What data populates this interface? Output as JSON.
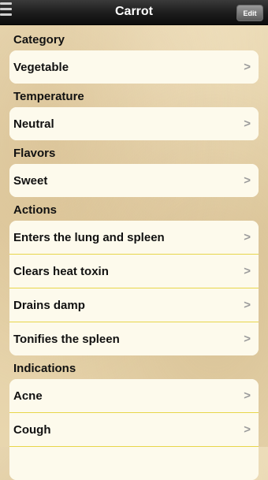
{
  "header": {
    "title": "Carrot",
    "edit_label": "Edit",
    "menu_icon": "menu-icon"
  },
  "sections": {
    "category": {
      "label": "Category",
      "items": [
        "Vegetable"
      ]
    },
    "temperature": {
      "label": "Temperature",
      "items": [
        "Neutral"
      ]
    },
    "flavors": {
      "label": "Flavors",
      "items": [
        "Sweet"
      ]
    },
    "actions": {
      "label": "Actions",
      "items": [
        "Enters the lung and spleen",
        "Clears heat toxin",
        "Drains damp",
        "Tonifies the spleen"
      ]
    },
    "indications": {
      "label": "Indications",
      "items": [
        "Acne",
        "Cough",
        ""
      ]
    }
  },
  "chevron": ">",
  "colors": {
    "row_bg": "#fdfaec",
    "divider": "#e7d64a",
    "chevron": "#9b9b9b"
  }
}
